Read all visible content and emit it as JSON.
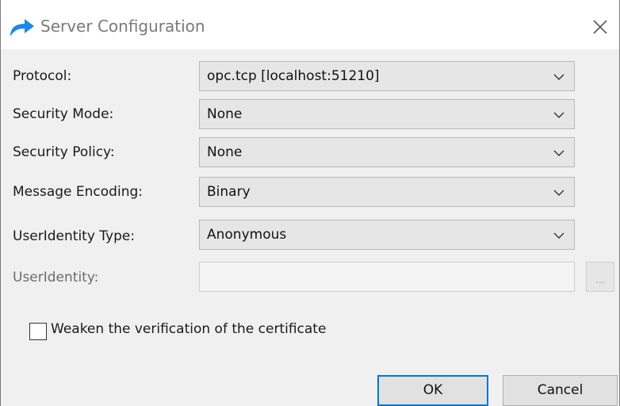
{
  "window": {
    "title": "Server Configuration",
    "icon": "arrow-share-icon",
    "close_icon": "close-icon"
  },
  "form": {
    "protocol": {
      "label": "Protocol:",
      "value": "opc.tcp [localhost:51210]"
    },
    "security_mode": {
      "label": "Security Mode:",
      "value": "None"
    },
    "security_policy": {
      "label": "Security Policy:",
      "value": "None"
    },
    "message_encoding": {
      "label": "Message Encoding:",
      "value": "Binary"
    },
    "user_identity_type": {
      "label": "UserIdentity Type:",
      "value": "Anonymous"
    },
    "user_identity": {
      "label": "UserIdentity:",
      "value": "",
      "browse_label": "..."
    }
  },
  "weaken_checkbox": {
    "label": "Weaken the verification of the certificate",
    "checked": false
  },
  "buttons": {
    "ok_label": "OK",
    "cancel_label": "Cancel"
  },
  "colors": {
    "accent": "#0078d7",
    "title_icon": "#1e88e5"
  }
}
